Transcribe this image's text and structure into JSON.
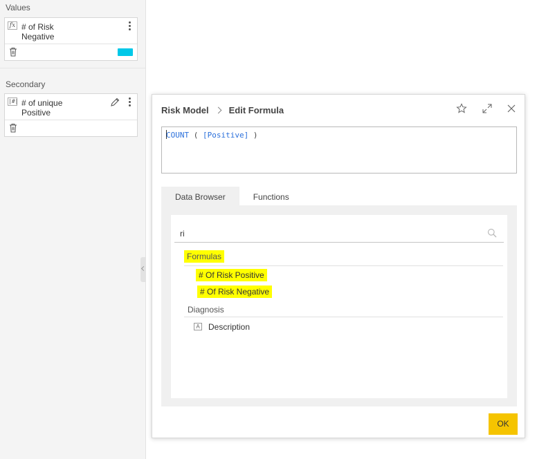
{
  "left_panel": {
    "values_title": "Values",
    "values_card": {
      "icon": "fx",
      "label_line1": "# of Risk",
      "label_line2": "Negative",
      "swatch_color": "#00c8e8"
    },
    "secondary_title": "Secondary",
    "secondary_card": {
      "icon": "|#|",
      "label_line1": "# of unique",
      "label_line2": "Positive"
    }
  },
  "dialog": {
    "breadcrumb_parent": "Risk Model",
    "breadcrumb_current": "Edit Formula",
    "formula": {
      "function": "COUNT",
      "open": " ( ",
      "argument": "[Positive]",
      "close": " )"
    },
    "tabs": [
      "Data Browser",
      "Functions"
    ],
    "search": {
      "value": "ri",
      "placeholder": ""
    },
    "groups": {
      "formulas": {
        "label": "Formulas",
        "items": [
          "# Of Risk Positive",
          "# Of Risk Negative"
        ]
      },
      "diagnosis": {
        "label": "Diagnosis",
        "items": [
          {
            "icon": "A",
            "label": "Description"
          }
        ]
      }
    },
    "ok_label": "OK",
    "highlight_color": "#ffff00",
    "accent_color": "#f5c400"
  }
}
